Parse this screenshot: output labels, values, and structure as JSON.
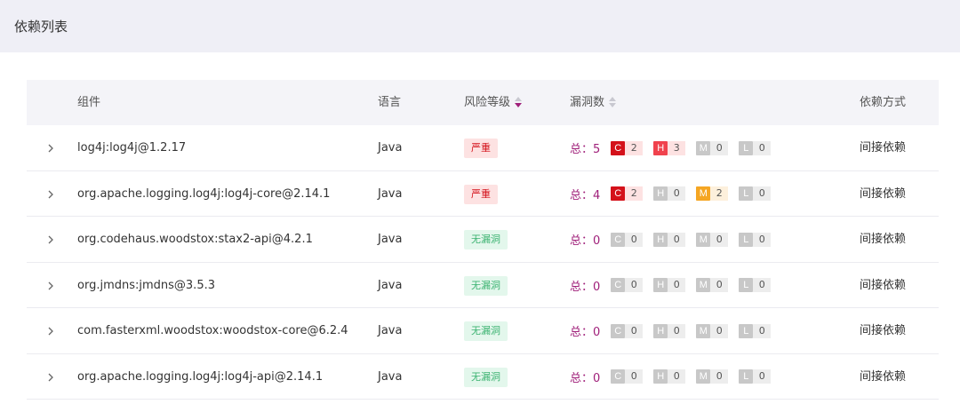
{
  "header": {
    "title": "依赖列表"
  },
  "columns": {
    "component": "组件",
    "language": "语言",
    "risk": "风险等级",
    "vulns": "漏洞数",
    "dep_type": "依赖方式"
  },
  "colors": {
    "accent": "#a0207a",
    "critical": "#d4111a",
    "high": "#f0424d",
    "medium": "#f5a623",
    "inactive": "#c8c8c8",
    "severe_bg": "#fde2e2",
    "severe_text": "#d4111a",
    "none_bg": "#e3f7ec",
    "none_text": "#3cb371"
  },
  "rows": [
    {
      "component": "log4j:log4j@1.2.17",
      "language": "Java",
      "risk": "严重",
      "risk_level": "severe",
      "total": "总：5",
      "c": {
        "letter": "C",
        "count": "2"
      },
      "h": {
        "letter": "H",
        "count": "3"
      },
      "m": {
        "letter": "M",
        "count": "0"
      },
      "l": {
        "letter": "L",
        "count": "0"
      },
      "dep_type": "间接依赖"
    },
    {
      "component": "org.apache.logging.log4j:log4j-core@2.14.1",
      "language": "Java",
      "risk": "严重",
      "risk_level": "severe",
      "total": "总：4",
      "c": {
        "letter": "C",
        "count": "2"
      },
      "h": {
        "letter": "H",
        "count": "0"
      },
      "m": {
        "letter": "M",
        "count": "2"
      },
      "l": {
        "letter": "L",
        "count": "0"
      },
      "dep_type": "间接依赖"
    },
    {
      "component": "org.codehaus.woodstox:stax2-api@4.2.1",
      "language": "Java",
      "risk": "无漏洞",
      "risk_level": "none",
      "total": "总：0",
      "c": {
        "letter": "C",
        "count": "0"
      },
      "h": {
        "letter": "H",
        "count": "0"
      },
      "m": {
        "letter": "M",
        "count": "0"
      },
      "l": {
        "letter": "L",
        "count": "0"
      },
      "dep_type": "间接依赖"
    },
    {
      "component": "org.jmdns:jmdns@3.5.3",
      "language": "Java",
      "risk": "无漏洞",
      "risk_level": "none",
      "total": "总：0",
      "c": {
        "letter": "C",
        "count": "0"
      },
      "h": {
        "letter": "H",
        "count": "0"
      },
      "m": {
        "letter": "M",
        "count": "0"
      },
      "l": {
        "letter": "L",
        "count": "0"
      },
      "dep_type": "间接依赖"
    },
    {
      "component": "com.fasterxml.woodstox:woodstox-core@6.2.4",
      "language": "Java",
      "risk": "无漏洞",
      "risk_level": "none",
      "total": "总：0",
      "c": {
        "letter": "C",
        "count": "0"
      },
      "h": {
        "letter": "H",
        "count": "0"
      },
      "m": {
        "letter": "M",
        "count": "0"
      },
      "l": {
        "letter": "L",
        "count": "0"
      },
      "dep_type": "间接依赖"
    },
    {
      "component": "org.apache.logging.log4j:log4j-api@2.14.1",
      "language": "Java",
      "risk": "无漏洞",
      "risk_level": "none",
      "total": "总：0",
      "c": {
        "letter": "C",
        "count": "0"
      },
      "h": {
        "letter": "H",
        "count": "0"
      },
      "m": {
        "letter": "M",
        "count": "0"
      },
      "l": {
        "letter": "L",
        "count": "0"
      },
      "dep_type": "间接依赖"
    }
  ]
}
